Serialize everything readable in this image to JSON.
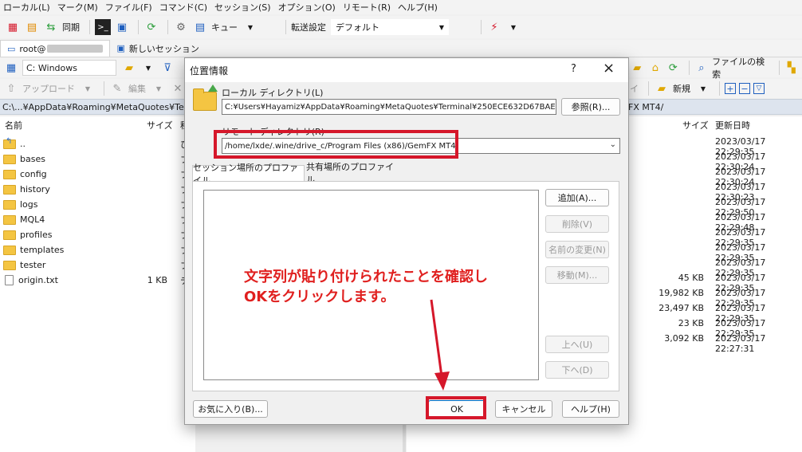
{
  "menu": [
    "ローカル(L)",
    "マーク(M)",
    "ファイル(F)",
    "コマンド(C)",
    "セッション(S)",
    "オプション(O)",
    "リモート(R)",
    "ヘルプ(H)"
  ],
  "toolbar": {
    "sync_label": "同期",
    "queue_label": "キュー",
    "transfer_label": "転送設定",
    "transfer_value": "デフォルト"
  },
  "tabs": {
    "session": "root@",
    "new_session": "新しいセッション"
  },
  "local": {
    "drive": "C: Windows",
    "upload": "アップロード",
    "edit": "編集",
    "path": "C:\\...¥AppData¥Roaming¥MetaQuotes¥Term",
    "col_name": "名前",
    "col_size": "サイズ",
    "col_type_partial": "種",
    "files": [
      {
        "name": "..",
        "size": "",
        "type": "ひ",
        "icon": "parent-folder"
      },
      {
        "name": "bases",
        "size": "",
        "type": "フ",
        "icon": "folder"
      },
      {
        "name": "config",
        "size": "",
        "type": "フ",
        "icon": "folder"
      },
      {
        "name": "history",
        "size": "",
        "type": "フ",
        "icon": "folder"
      },
      {
        "name": "logs",
        "size": "",
        "type": "フ",
        "icon": "folder"
      },
      {
        "name": "MQL4",
        "size": "",
        "type": "フ",
        "icon": "folder"
      },
      {
        "name": "profiles",
        "size": "",
        "type": "フ",
        "icon": "folder"
      },
      {
        "name": "templates",
        "size": "",
        "type": "フ",
        "icon": "folder"
      },
      {
        "name": "tester",
        "size": "",
        "type": "フ",
        "icon": "folder"
      },
      {
        "name": "origin.txt",
        "size": "1 KB",
        "type": "テ",
        "icon": "text-file"
      }
    ]
  },
  "remote": {
    "find_files": "ファイルの検索",
    "new_label": "新規",
    "path_tail": "FX MT4/",
    "col_size": "サイズ",
    "col_date": "更新日時",
    "rows": [
      {
        "size": "",
        "date": "2023/03/17 22:29:35"
      },
      {
        "size": "",
        "date": "2023/03/17 22:30:24"
      },
      {
        "size": "",
        "date": "2023/03/17 22:30:24"
      },
      {
        "size": "",
        "date": "2023/03/17 22:30:23"
      },
      {
        "size": "",
        "date": "2023/03/17 22:29:50"
      },
      {
        "size": "",
        "date": "2023/03/17 22:29:48"
      },
      {
        "size": "",
        "date": "2023/03/17 22:29:35"
      },
      {
        "size": "",
        "date": "2023/03/17 22:29:35"
      },
      {
        "size": "",
        "date": "2023/03/17 22:29:35"
      },
      {
        "size": "45 KB",
        "date": "2023/03/17 22:29:35"
      },
      {
        "size": "19,982 KB",
        "date": "2023/03/17 22:29:35"
      },
      {
        "size": "23,497 KB",
        "date": "2023/03/17 22:29:35"
      },
      {
        "size": "23 KB",
        "date": "2023/03/17 22:29:35"
      },
      {
        "size": "3,092 KB",
        "date": "2023/03/17 22:27:31"
      }
    ]
  },
  "dialog": {
    "title": "位置情報",
    "help_mark": "?",
    "local_dir_label": "ローカル ディレクトリ(L)",
    "local_dir_value": "C:¥Users¥Hayamiz¥AppData¥Roaming¥MetaQuotes¥Terminal¥250ECE632D67BAE",
    "browse": "参照(R)...",
    "remote_dir_label": "リモート ディレクトリ(R)",
    "remote_dir_value": "/home/lxde/.wine/drive_c/Program Files (x86)/GemFX MT4",
    "tab_session": "セッション場所のプロファイル",
    "tab_shared": "共有場所のプロファイル",
    "btn_add": "追加(A)...",
    "btn_delete": "削除(V)",
    "btn_rename": "名前の変更(N)",
    "btn_move": "移動(M)...",
    "btn_up": "上へ(U)",
    "btn_down": "下へ(D)",
    "btn_favorite": "お気に入り(B)...",
    "btn_ok": "OK",
    "btn_cancel": "キャンセル",
    "btn_help": "ヘルプ(H)"
  },
  "annotation": {
    "line1": "文字列が貼り付けられたことを確認し",
    "line2": "OKをクリックします。",
    "color": "#e0201f"
  },
  "colors": {
    "highlight_red": "#d5172a",
    "path_bar": "#dde4ee",
    "folder": "#f4c542"
  }
}
